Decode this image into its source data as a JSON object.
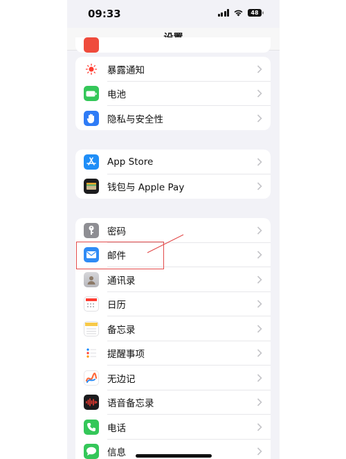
{
  "status": {
    "time": "09:33",
    "battery": "48"
  },
  "navbar": {
    "title": "设置"
  },
  "groups": [
    {
      "items": [
        {
          "label": "暴露通知",
          "icon": "exposure-sun-icon",
          "color": "#ffffff"
        },
        {
          "label": "电池",
          "icon": "battery-icon",
          "color": "#34c759"
        },
        {
          "label": "隐私与安全性",
          "icon": "hand-icon",
          "color": "#2f7cf6"
        }
      ]
    },
    {
      "items": [
        {
          "label": "App Store",
          "icon": "app-store-icon",
          "color": "#1f8ef7"
        },
        {
          "label": "钱包与 Apple Pay",
          "icon": "wallet-icon",
          "color": "#1c1c1e"
        }
      ]
    },
    {
      "items": [
        {
          "label": "密码",
          "icon": "key-icon",
          "color": "#8e8e93"
        },
        {
          "label": "邮件",
          "icon": "mail-icon",
          "color": "#2f8bf5"
        },
        {
          "label": "通讯录",
          "icon": "contacts-icon",
          "color": "#c7c7cc"
        },
        {
          "label": "日历",
          "icon": "calendar-icon",
          "color": "#ffffff"
        },
        {
          "label": "备忘录",
          "icon": "notes-icon",
          "color": "#ffffff"
        },
        {
          "label": "提醒事项",
          "icon": "reminders-icon",
          "color": "#ffffff"
        },
        {
          "label": "无边记",
          "icon": "freeform-icon",
          "color": "#ffffff"
        },
        {
          "label": "语音备忘录",
          "icon": "voice-memos-icon",
          "color": "#1c1c1e"
        },
        {
          "label": "电话",
          "icon": "phone-icon",
          "color": "#34c759"
        },
        {
          "label": "信息",
          "icon": "messages-icon",
          "color": "#34c759"
        }
      ]
    }
  ],
  "colors": {
    "annotation": "#e24a4a",
    "background": "#f2f2f7"
  }
}
